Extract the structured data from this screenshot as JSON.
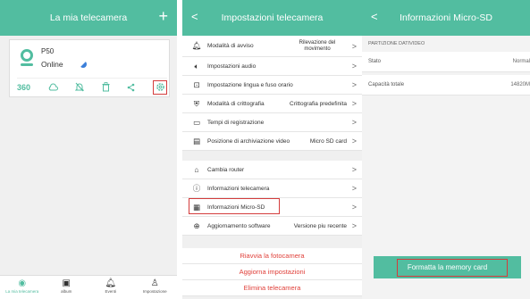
{
  "panel1": {
    "title": "La mia telecamera",
    "add_label": "+",
    "camera": {
      "name": "P50",
      "status": "Online"
    },
    "action_360": "360",
    "tabs": [
      {
        "label": "La mia telecamera",
        "icon": "camera-icon"
      },
      {
        "label": "album",
        "icon": "album-icon"
      },
      {
        "label": "Eventi",
        "icon": "bell-icon"
      },
      {
        "label": "Impostazione",
        "icon": "person-icon"
      }
    ]
  },
  "panel2": {
    "back": "<",
    "title": "Impostazioni telecamera",
    "rows": [
      {
        "label": "Modalità di avviso",
        "value": "Rilevazione del movimento"
      },
      {
        "label": "Impostazioni audio",
        "value": ""
      },
      {
        "label": "Impostazione lingua e fuso orario",
        "value": ""
      },
      {
        "label": "Modalità di crittografia",
        "value": "Crittografia predefinita"
      },
      {
        "label": "Tempi di registrazione",
        "value": ""
      },
      {
        "label": "Posizione di archiviazione video",
        "value": "Micro SD card"
      },
      {
        "label": "Cambia router",
        "value": ""
      },
      {
        "label": "Informazioni telecamera",
        "value": ""
      },
      {
        "label": "Informazioni Micro-SD",
        "value": ""
      },
      {
        "label": "Aggiornamento software",
        "value": "Versione piu recente"
      }
    ],
    "actions": [
      "Riavvia la fotocamera",
      "Aggiorna impostazioni",
      "Elimina telecamera"
    ]
  },
  "panel3": {
    "back": "<",
    "title": "Informazioni Micro-SD",
    "section": "PARTIZIONE DATIVIDEO",
    "rows": [
      {
        "label": "Stato",
        "value": "Normal"
      },
      {
        "label": "Capacità totale",
        "value": "14820M"
      }
    ],
    "format_button": "Formatta la memory card"
  },
  "colors": {
    "accent": "#52bda0",
    "highlight": "#d43c3c",
    "danger": "#e0403a"
  }
}
